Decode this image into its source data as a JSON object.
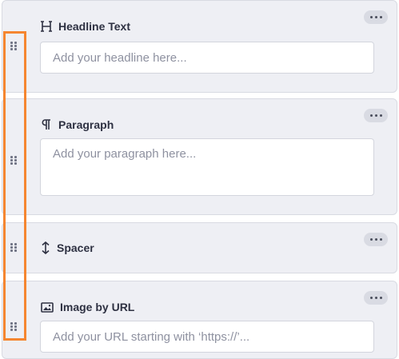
{
  "blocks": [
    {
      "title": "Headline Text",
      "icon": "heading-icon",
      "placeholder": "Add your headline here..."
    },
    {
      "title": "Paragraph",
      "icon": "paragraph-icon",
      "placeholder": "Add your paragraph here..."
    },
    {
      "title": "Spacer",
      "icon": "vertical-resize-icon"
    },
    {
      "title": "Image by URL",
      "icon": "image-icon",
      "placeholder": "Add your URL starting with ‘https://’..."
    }
  ],
  "colors": {
    "highlight": "#f58630",
    "panel": "#eeeff4"
  }
}
